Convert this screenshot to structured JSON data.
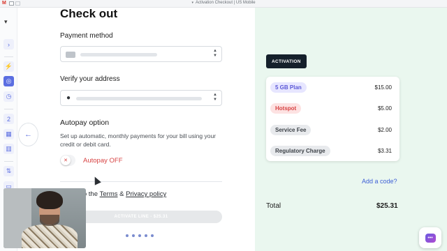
{
  "browser": {
    "tab_title": "Activation Checkout | US Mobile"
  },
  "checkout": {
    "title": "Check out",
    "payment_method_label": "Payment method",
    "verify_address_label": "Verify your address",
    "autopay_title": "Autopay option",
    "autopay_description": "Set up automatic, monthly payments for your bill using your credit or debit card.",
    "autopay_state": "Autopay OFF",
    "agree_prefix": "ee to the",
    "terms_label": "Terms",
    "agree_amp": "&",
    "privacy_label": "Privacy policy",
    "activate_button": "ACTIVATE LINE - $25.31",
    "steps_total": 5
  },
  "summary": {
    "badge": "ACTIVATION",
    "items": [
      {
        "label": "5 GB Plan",
        "amount": "$15.00",
        "style": "plan"
      },
      {
        "label": "Hotspot",
        "amount": "$5.00",
        "style": "hot"
      },
      {
        "label": "Service Fee",
        "amount": "$2.00",
        "style": "gray"
      },
      {
        "label": "Regulatory Charge",
        "amount": "$3.31",
        "style": "gray"
      }
    ],
    "add_code": "Add a code?",
    "total_label": "Total",
    "total_value": "$25.31"
  },
  "colors": {
    "accent": "#5b6ee1",
    "panel_bg": "#eaf7ef",
    "off_red": "#d74242",
    "link_blue": "#3d5fd6"
  },
  "icons": {
    "back": "arrow-left-icon",
    "chat": "chat-icon",
    "location": "location-pin-icon",
    "card": "credit-card-icon"
  }
}
